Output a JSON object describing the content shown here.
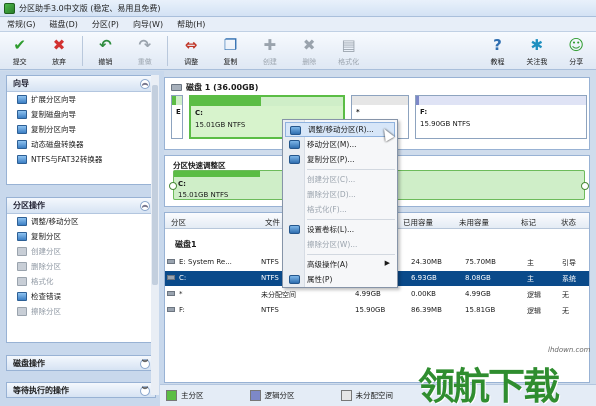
{
  "window": {
    "title": "分区助手3.0中文版 (稳定、易用且免费)"
  },
  "menu": [
    "常规(G)",
    "磁盘(D)",
    "分区(P)",
    "向导(W)",
    "帮助(H)"
  ],
  "toolbar": {
    "left": [
      {
        "label": "提交",
        "icon": "check-icon",
        "glyph": "✔",
        "color": "#2e9c2e",
        "disabled": false
      },
      {
        "label": "放弃",
        "icon": "discard-x-icon",
        "glyph": "✖",
        "color": "#d23131",
        "disabled": false
      },
      {
        "label": "撤销",
        "icon": "undo-icon",
        "glyph": "↶",
        "color": "#2e8c3e",
        "disabled": false
      },
      {
        "label": "重做",
        "icon": "redo-icon",
        "glyph": "↷",
        "color": "#9aa3ad",
        "disabled": true
      },
      {
        "label": "调整",
        "icon": "resize-disk-icon",
        "glyph": "⇔",
        "color": "#c0392b",
        "disabled": false
      },
      {
        "label": "复制",
        "icon": "copy-disk-icon",
        "glyph": "❐",
        "color": "#2f6eb0",
        "disabled": false
      },
      {
        "label": "创建",
        "icon": "create-disk-icon",
        "glyph": "✚",
        "color": "#9aa3ad",
        "disabled": true
      },
      {
        "label": "删除",
        "icon": "delete-disk-icon",
        "glyph": "✖",
        "color": "#9aa3ad",
        "disabled": true
      },
      {
        "label": "格式化",
        "icon": "format-disk-icon",
        "glyph": "▤",
        "color": "#9aa3ad",
        "disabled": true
      }
    ],
    "right": [
      {
        "label": "教程",
        "icon": "help-icon",
        "glyph": "?",
        "color": "#2f6eb0",
        "disabled": false
      },
      {
        "label": "关注我",
        "icon": "follow-globe-icon",
        "glyph": "✱",
        "color": "#1e8fbf",
        "disabled": false
      },
      {
        "label": "分享",
        "icon": "share-people-icon",
        "glyph": "☺",
        "color": "#2e9c2e",
        "disabled": false
      }
    ]
  },
  "sidebar": {
    "wizard": {
      "title": "向导",
      "items": [
        {
          "label": "扩展分区向导",
          "disabled": false
        },
        {
          "label": "复制磁盘向导",
          "disabled": false
        },
        {
          "label": "复制分区向导",
          "disabled": false
        },
        {
          "label": "动态磁盘转换器",
          "disabled": false
        },
        {
          "label": "NTFS与FAT32转换器",
          "disabled": false
        }
      ]
    },
    "partition_ops": {
      "title": "分区操作",
      "items": [
        {
          "label": "调整/移动分区",
          "disabled": false
        },
        {
          "label": "复制分区",
          "disabled": false
        },
        {
          "label": "创建分区",
          "disabled": true
        },
        {
          "label": "删除分区",
          "disabled": true
        },
        {
          "label": "格式化",
          "disabled": true
        },
        {
          "label": "检查错误",
          "disabled": false
        },
        {
          "label": "擦除分区",
          "disabled": true
        }
      ]
    },
    "disk_ops": {
      "title": "磁盘操作"
    },
    "pending_ops": {
      "title": "等待执行的操作"
    }
  },
  "disk_map": {
    "title": "磁盘 1 (36.00GB)",
    "partitions": [
      {
        "letter": "E",
        "info": "",
        "used_fraction": 0.4,
        "color": "#5bbd45",
        "border": "#8da3bf"
      },
      {
        "letter": "C:",
        "info": "15.01GB NTFS",
        "used_fraction": 0.46,
        "color": "#5bbd45",
        "border": "#5bbd45"
      },
      {
        "letter": "*",
        "info": "",
        "used_fraction": 0.0,
        "color": "#b5b5b5",
        "border": "#8da3bf"
      },
      {
        "letter": "F:",
        "info": "15.90GB NTFS",
        "used_fraction": 0.02,
        "color": "#7d88c8",
        "border": "#8da3bf"
      }
    ]
  },
  "resize": {
    "title": "分区快速调整区",
    "letter": "C:",
    "info": "15.01GB NTFS"
  },
  "table": {
    "headers": [
      "分区",
      "文件",
      "",
      "",
      "已用容量",
      "未用容量",
      "标记",
      "状态"
    ],
    "disk_label": "磁盘1",
    "rows": [
      {
        "name": "E: System Re...",
        "fs": "NTFS",
        "capacity": "",
        "used": "24.30MB",
        "free": "75.70MB",
        "flag": "主",
        "status": "引导",
        "selected": false
      },
      {
        "name": "C:",
        "fs": "NTFS",
        "capacity": "",
        "used": "6.93GB",
        "free": "8.08GB",
        "flag": "主",
        "status": "系统",
        "selected": true
      },
      {
        "name": "*",
        "fs": "未分配空间",
        "capacity": "4.99GB",
        "used": "0.00KB",
        "free": "4.99GB",
        "flag": "逻辑",
        "status": "无",
        "selected": false
      },
      {
        "name": "F:",
        "fs": "NTFS",
        "capacity": "15.90GB",
        "used": "86.39MB",
        "free": "15.81GB",
        "flag": "逻辑",
        "status": "无",
        "selected": false
      }
    ]
  },
  "context_menu": [
    {
      "label": "调整/移动分区(R)...",
      "disabled": false,
      "highlighted": true,
      "icon": true,
      "submenu": false
    },
    {
      "label": "移动分区(M)...",
      "disabled": false,
      "highlighted": false,
      "icon": true,
      "submenu": false
    },
    {
      "label": "复制分区(P)...",
      "disabled": false,
      "highlighted": false,
      "icon": true,
      "submenu": false
    },
    {
      "sep": true
    },
    {
      "label": "创建分区(C)...",
      "disabled": true,
      "highlighted": false,
      "icon": false,
      "submenu": false
    },
    {
      "label": "删除分区(D)...",
      "disabled": true,
      "highlighted": false,
      "icon": false,
      "submenu": false
    },
    {
      "label": "格式化(F)...",
      "disabled": true,
      "highlighted": false,
      "icon": false,
      "submenu": false
    },
    {
      "sep": true
    },
    {
      "label": "设置卷标(L)...",
      "disabled": false,
      "highlighted": false,
      "icon": true,
      "submenu": false
    },
    {
      "label": "擦除分区(W)...",
      "disabled": true,
      "highlighted": false,
      "icon": false,
      "submenu": false
    },
    {
      "sep": true
    },
    {
      "label": "高级操作(A)",
      "disabled": false,
      "highlighted": false,
      "icon": false,
      "submenu": true
    },
    {
      "label": "属性(P)",
      "disabled": false,
      "highlighted": false,
      "icon": true,
      "submenu": false
    }
  ],
  "legend": [
    {
      "label": "主分区",
      "color": "#5bbd45"
    },
    {
      "label": "逻辑分区",
      "color": "#7d88c8"
    },
    {
      "label": "未分配空间",
      "color": "#e6e6e6"
    }
  ],
  "watermark": {
    "text": "领航下载",
    "url": "lhdown.com"
  }
}
